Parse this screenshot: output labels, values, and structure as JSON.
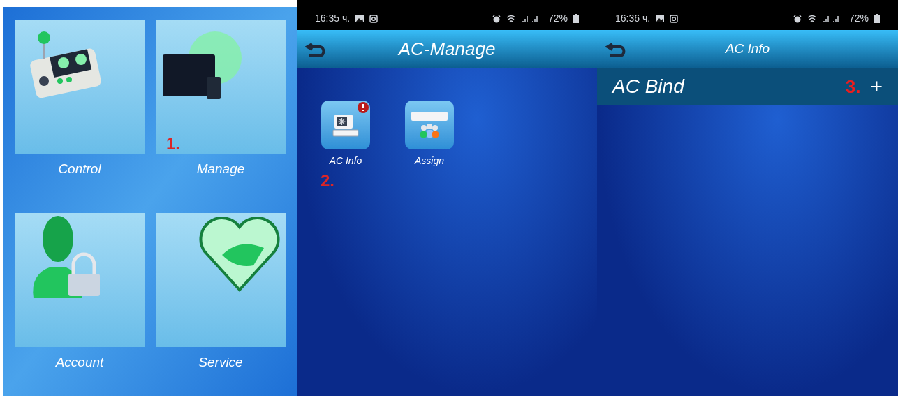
{
  "home_screen": {
    "tiles": [
      {
        "label": "Control",
        "kind": "controller"
      },
      {
        "label": "Manage",
        "kind": "monitor"
      },
      {
        "label": "Account",
        "kind": "user-lock"
      },
      {
        "label": "Service",
        "kind": "heart"
      }
    ],
    "step_marker": "1."
  },
  "manage_screen": {
    "status_bar": {
      "time": "16:35 ч.",
      "battery": "72%"
    },
    "header": {
      "title": "AC-Manage"
    },
    "apps": [
      {
        "label": "AC Info",
        "kind": "ac-unit",
        "alert": true,
        "marker": "2."
      },
      {
        "label": "Assign",
        "kind": "ac-users",
        "alert": false
      }
    ]
  },
  "info_screen": {
    "status_bar": {
      "time": "16:36 ч.",
      "battery": "72%"
    },
    "header": {
      "title": "AC Info"
    },
    "section": {
      "title": "AC Bind",
      "marker": "3.",
      "add": "+"
    }
  }
}
